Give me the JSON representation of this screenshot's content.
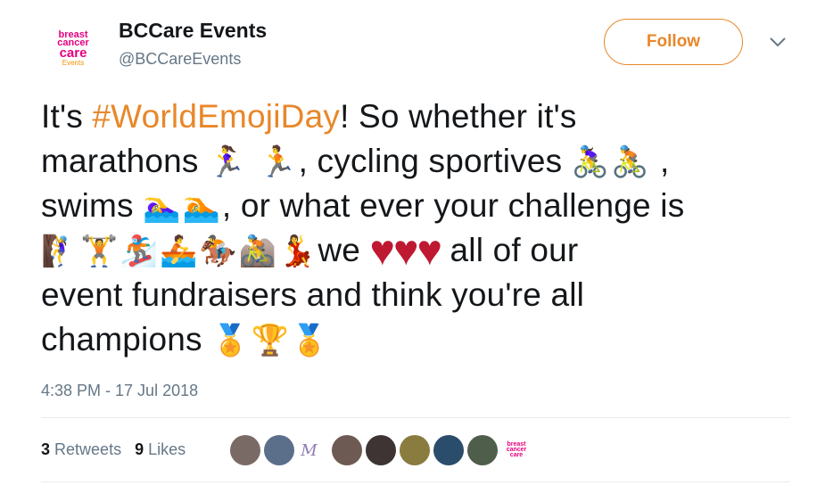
{
  "account": {
    "name": "BCCare Events",
    "handle": "@BCCareEvents",
    "avatar_lines": [
      "breast",
      "cancer",
      "care",
      "Events"
    ]
  },
  "follow_label": "Follow",
  "tweet": {
    "lines": [
      {
        "pre": "It's ",
        "hashtag": "#WorldEmojiDay",
        "post": "! So whether it's"
      },
      {
        "text": "marathons",
        "emoji": "🏃‍♀️ 🏃",
        "post": ", cycling sportives",
        "emoji2": "🚴‍♀️🚴",
        "post2": " ,"
      },
      {
        "text": "swims",
        "emoji": "🏊‍♀️🏊",
        "post": ", or what ever your challenge is"
      },
      {
        "emoji": "🧗‍♀️🏋️🏂🚣🏇🚵💃",
        "post": "we ",
        "hearts": "♥♥♥",
        "post2": " all of our"
      },
      {
        "text": "event fundraisers and think you're all"
      },
      {
        "text": "champions ",
        "emoji": "🏅🏆🏅"
      }
    ]
  },
  "timestamp": "4:38 PM - 17 Jul 2018",
  "stats": {
    "retweets_count": "3",
    "retweets_label": "Retweets",
    "likes_count": "9",
    "likes_label": "Likes"
  },
  "likers": [
    {
      "bg": "#7a6a66"
    },
    {
      "bg": "#5b6f8a"
    },
    {
      "text": "M "
    },
    {
      "bg": "#6d5a52"
    },
    {
      "bg": "#3d3433"
    },
    {
      "bg": "#8a7b3f"
    },
    {
      "bg": "#2a4d6b"
    },
    {
      "bg": "#4e5e4a"
    },
    {
      "bc": "breast cancer care"
    }
  ],
  "colors": {
    "accent": "#e8872a",
    "heart": "#be1931",
    "muted": "#657786"
  }
}
